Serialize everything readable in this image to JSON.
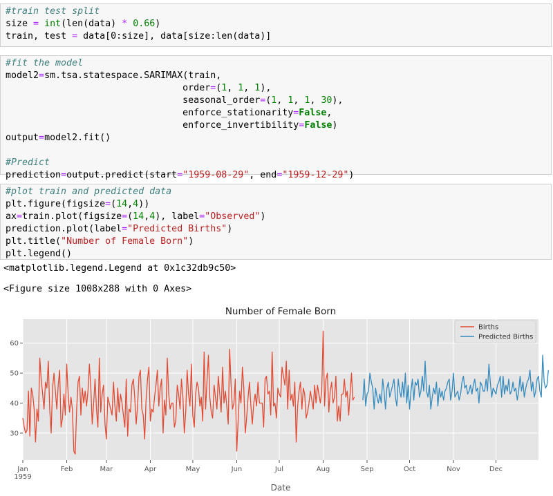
{
  "cells": [
    {
      "lines": [
        [
          [
            "c",
            "#train test split"
          ]
        ],
        [
          [
            "t",
            "size "
          ],
          [
            "o",
            "="
          ],
          [
            "t",
            " "
          ],
          [
            "n",
            "int"
          ],
          [
            "t",
            "(len(data) "
          ],
          [
            "o",
            "*"
          ],
          [
            "t",
            " "
          ],
          [
            "n",
            "0.66"
          ],
          [
            "t",
            ")"
          ]
        ],
        [
          [
            "t",
            "train, test "
          ],
          [
            "o",
            "="
          ],
          [
            "t",
            " data[0:size], data[size:len(data)]"
          ]
        ]
      ]
    },
    {
      "lines": [
        [
          [
            "c",
            "#fit the model"
          ]
        ],
        [
          [
            "t",
            "model2"
          ],
          [
            "o",
            "="
          ],
          [
            "t",
            "sm.tsa.statespace.SARIMAX(train,"
          ]
        ],
        [
          [
            "t",
            "                                order"
          ],
          [
            "o",
            "="
          ],
          [
            "t",
            "("
          ],
          [
            "n",
            "1"
          ],
          [
            "t",
            ", "
          ],
          [
            "n",
            "1"
          ],
          [
            "t",
            ", "
          ],
          [
            "n",
            "1"
          ],
          [
            "t",
            "),"
          ]
        ],
        [
          [
            "t",
            "                                seasonal_order"
          ],
          [
            "o",
            "="
          ],
          [
            "t",
            "("
          ],
          [
            "n",
            "1"
          ],
          [
            "t",
            ", "
          ],
          [
            "n",
            "1"
          ],
          [
            "t",
            ", "
          ],
          [
            "n",
            "1"
          ],
          [
            "t",
            ", "
          ],
          [
            "n",
            "30"
          ],
          [
            "t",
            "),"
          ]
        ],
        [
          [
            "t",
            "                                enforce_stationarity"
          ],
          [
            "o",
            "="
          ],
          [
            "k",
            "False"
          ],
          [
            "t",
            ","
          ]
        ],
        [
          [
            "t",
            "                                enforce_invertibility"
          ],
          [
            "o",
            "="
          ],
          [
            "k",
            "False"
          ],
          [
            "t",
            ")"
          ]
        ],
        [
          [
            "t",
            "output"
          ],
          [
            "o",
            "="
          ],
          [
            "t",
            "model2.fit()"
          ]
        ],
        [
          [
            "t",
            ""
          ]
        ],
        [
          [
            "c",
            "#Predict"
          ]
        ],
        [
          [
            "t",
            "prediction"
          ],
          [
            "o",
            "="
          ],
          [
            "t",
            "output.predict(start"
          ],
          [
            "o",
            "="
          ],
          [
            "s",
            "\"1959-08-29\""
          ],
          [
            "t",
            ", end"
          ],
          [
            "o",
            "="
          ],
          [
            "s",
            "\"1959-12-29\""
          ],
          [
            "t",
            ")"
          ]
        ]
      ]
    },
    {
      "lines": [
        [
          [
            "c",
            "#plot train and predicted data"
          ]
        ],
        [
          [
            "t",
            "plt.figure(figsize"
          ],
          [
            "o",
            "="
          ],
          [
            "t",
            "("
          ],
          [
            "n",
            "14"
          ],
          [
            "t",
            ","
          ],
          [
            "n",
            "4"
          ],
          [
            "t",
            "))"
          ]
        ],
        [
          [
            "t",
            "ax"
          ],
          [
            "o",
            "="
          ],
          [
            "t",
            "train.plot(figsize"
          ],
          [
            "o",
            "="
          ],
          [
            "t",
            "("
          ],
          [
            "n",
            "14"
          ],
          [
            "t",
            ","
          ],
          [
            "n",
            "4"
          ],
          [
            "t",
            "), label"
          ],
          [
            "o",
            "="
          ],
          [
            "s",
            "\"Observed\""
          ],
          [
            "t",
            ")"
          ]
        ],
        [
          [
            "t",
            "prediction.plot(label"
          ],
          [
            "o",
            "="
          ],
          [
            "s",
            "\"Predicted Births\""
          ],
          [
            "t",
            ")"
          ]
        ],
        [
          [
            "t",
            "plt.title("
          ],
          [
            "s",
            "\"Number of Female Born\""
          ],
          [
            "t",
            ")"
          ]
        ],
        [
          [
            "t",
            "plt.legend()"
          ]
        ]
      ]
    }
  ],
  "outputs": {
    "legend_repr": "<matplotlib.legend.Legend at 0x1c32db9c50>",
    "figure_repr": "<Figure size 1008x288 with 0 Axes>"
  },
  "chart_data": {
    "type": "line",
    "title": "Number of Female Born",
    "xlabel": "Date",
    "ylabel": "",
    "ylim": [
      21,
      68
    ],
    "xlim": [
      "1959-01-01",
      "1959-12-31"
    ],
    "grid": true,
    "legend_position": "top-right",
    "x_ticks": [
      "Jan\n1959",
      "Feb",
      "Mar",
      "Apr",
      "May",
      "Jun",
      "Jul",
      "Aug",
      "Sep",
      "Oct",
      "Nov",
      "Dec"
    ],
    "y_ticks": [
      30,
      40,
      50,
      60
    ],
    "colors": {
      "Births": "#e24a33",
      "Predicted Births": "#348abd",
      "plot_bg": "#e5e5e5",
      "grid": "#ffffff"
    },
    "series": [
      {
        "name": "Births",
        "start": "1959-01-01",
        "values": [
          35,
          32,
          30,
          31,
          44,
          29,
          45,
          43,
          38,
          27,
          38,
          34,
          55,
          48,
          43,
          38,
          47,
          45,
          54,
          38,
          30,
          45,
          50,
          44,
          38,
          46,
          51,
          32,
          35,
          43,
          36,
          53,
          43,
          37,
          42,
          38,
          24,
          23,
          38,
          47,
          49,
          36,
          45,
          40,
          44,
          39,
          44,
          53,
          45,
          33,
          40,
          48,
          38,
          32,
          55,
          37,
          43,
          46,
          33,
          28,
          42,
          40,
          38,
          36,
          47,
          39,
          34,
          45,
          37,
          43,
          40,
          36,
          32,
          48,
          29,
          38,
          37,
          46,
          48,
          42,
          33,
          39,
          49,
          51,
          38,
          36,
          28,
          41,
          48,
          52,
          34,
          38,
          37,
          42,
          46,
          51,
          39,
          45,
          48,
          30,
          41,
          36,
          55,
          43,
          38,
          40,
          40,
          32,
          34,
          46,
          43,
          38,
          48,
          42,
          30,
          37,
          51,
          43,
          39,
          53,
          36,
          32,
          43,
          47,
          45,
          39,
          42,
          34,
          57,
          38,
          47,
          56,
          42,
          37,
          35,
          46,
          42,
          38,
          49,
          43,
          37,
          52,
          40,
          44,
          39,
          33,
          58,
          46,
          38,
          40,
          48,
          24,
          34,
          44,
          40,
          52,
          45,
          30,
          35,
          42,
          47,
          39,
          33,
          40,
          43,
          39,
          47,
          40,
          40,
          40,
          32,
          48,
          49,
          43,
          44,
          36,
          57,
          39,
          40,
          35,
          45,
          43,
          42,
          52,
          49,
          46,
          54,
          38,
          51,
          41,
          43,
          39,
          47,
          27,
          39,
          44,
          47,
          38,
          45,
          43,
          35,
          37,
          40,
          44,
          41,
          38,
          46,
          40,
          46,
          43,
          40,
          44,
          64,
          39,
          48,
          50,
          37,
          44,
          47,
          40,
          42,
          49,
          34,
          39,
          34,
          43,
          43,
          48,
          42,
          44,
          36,
          43,
          50,
          41,
          42
        ]
      },
      {
        "name": "Predicted Births",
        "start": "1959-08-29",
        "values": [
          41,
          48,
          39,
          43,
          44,
          50,
          47,
          45,
          38,
          45,
          42,
          40,
          43,
          40,
          48,
          44,
          38,
          45,
          47,
          42,
          44,
          46,
          48,
          42,
          39,
          48,
          44,
          42,
          47,
          42,
          50,
          40,
          46,
          38,
          44,
          48,
          41,
          47,
          46,
          48,
          42,
          44,
          49,
          44,
          54,
          44,
          42,
          46,
          38,
          42,
          45,
          43,
          47,
          39,
          45,
          42,
          44,
          41,
          44,
          45,
          47,
          48,
          41,
          44,
          50,
          42,
          43,
          44,
          41,
          43,
          47,
          49,
          45,
          46,
          43,
          44,
          46,
          43,
          46,
          48,
          44,
          45,
          40,
          47,
          46,
          44,
          44,
          48,
          44,
          53,
          47,
          42,
          45,
          44,
          43,
          46,
          47,
          49,
          42,
          49,
          43,
          46,
          44,
          48,
          43,
          44,
          47,
          44,
          45,
          41,
          44,
          49,
          44,
          47,
          42,
          45,
          47,
          48,
          51,
          44,
          47,
          42,
          44,
          48,
          49,
          44,
          42,
          56,
          47,
          45,
          46,
          51
        ]
      }
    ]
  }
}
